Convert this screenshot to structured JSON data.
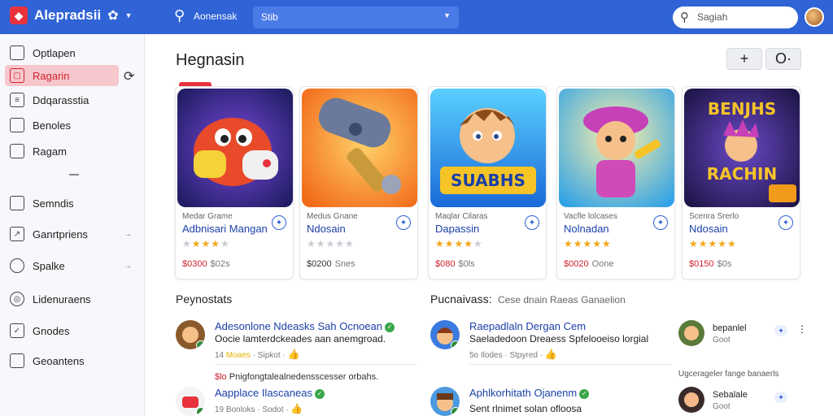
{
  "topbar": {
    "app_name": "Alepradsii",
    "search_label": "Aonensak",
    "select_value": "Stib",
    "search_placeholder": "Sagiah"
  },
  "sidebar": {
    "items": [
      {
        "label": "Optlapen",
        "icon": "doc-icon"
      },
      {
        "label": "Ragarin",
        "icon": "tag-icon",
        "active": true
      },
      {
        "label": "Ddqarasstia",
        "icon": "list-icon"
      },
      {
        "label": "Benoles",
        "icon": "book-icon"
      },
      {
        "label": "Ragam",
        "icon": "square-icon"
      },
      {
        "label": "Semndis",
        "icon": "box-icon"
      },
      {
        "label": "Ganrtpriens",
        "icon": "image-icon",
        "arrow": true
      },
      {
        "label": "Spalke",
        "icon": "person-icon",
        "arrow": true
      },
      {
        "label": "Lidenuraens",
        "icon": "globe-icon"
      },
      {
        "label": "Gnodes",
        "icon": "check-icon"
      },
      {
        "label": "Geoantens",
        "icon": "chat-icon"
      }
    ]
  },
  "main": {
    "title": "Hegnasin",
    "add_button": "+",
    "options_button": "O·"
  },
  "cards": [
    {
      "subtitle": "Medar Grame",
      "title": "Adbnisari Mangan",
      "rating": 4,
      "price": "$0300",
      "sales": "$02s",
      "colors": [
        "#5a2fb8",
        "#e0442a"
      ]
    },
    {
      "subtitle": "Medus Gnane",
      "title": "Ndosain",
      "rating": 0,
      "price": "$0200",
      "sales": "Snes",
      "colors": [
        "#ff9a2a",
        "#6a7a9a"
      ]
    },
    {
      "subtitle": "Maqlar Cilaras",
      "title": "Dapassin",
      "rating": 4,
      "price": "$080",
      "sales": "$0ls",
      "colors": [
        "#2ba8e8",
        "#f7c427"
      ]
    },
    {
      "subtitle": "Vacfle lolcases",
      "title": "Nolnadan",
      "rating": 5,
      "price": "$0020",
      "sales": "Oone",
      "colors": [
        "#ffd44a",
        "#c640b8"
      ]
    },
    {
      "subtitle": "Scenra Srerlo",
      "title": "Ndosain",
      "rating": 5,
      "price": "$0150",
      "sales": "$0s",
      "colors": [
        "#3a2a7a",
        "#f7b52a"
      ]
    }
  ],
  "section_left": {
    "title": "Peynostats",
    "posts": [
      {
        "name": "Adesonlone Ndeasks Sah Ocnoean",
        "text": "Oocie lamterdckeades aan anemgroad.",
        "meta_num": "14",
        "meta_hl": "Moaes",
        "meta_rest": "· Sipkot ·"
      },
      {
        "name": "Aapplace Ilascaneas",
        "text": "",
        "meta_num": "19",
        "meta_hl": "",
        "meta_rest": "Bonloks · Sodot ·"
      }
    ],
    "note_red": "$lo",
    "note_text": "Pnigfongtalealnedensscesser orbahs."
  },
  "section_mid": {
    "title": "Pucnaivass:",
    "caption": "Cese dnain Raeas Ganaelion",
    "posts": [
      {
        "name": "Raepadlaln Dergan Cem",
        "text": "Saeladedoon Dreaess Spfelooeiso lorgial",
        "meta_num": "5o",
        "meta_hl": "",
        "meta_rest": "Ilodes · Stpyred ·"
      },
      {
        "name": "Aphlkorhitath Ojanenm",
        "text": "Sent rlnimet solan ofloosa",
        "meta_num": "",
        "meta_hl": "",
        "meta_rest": ""
      }
    ]
  },
  "section_right": {
    "users": [
      {
        "name": "bepanlel",
        "sub": "Goot"
      },
      {
        "name": "Sebalale",
        "sub": "Goot"
      }
    ],
    "caption": "Ugcerageler fange banaerls"
  }
}
